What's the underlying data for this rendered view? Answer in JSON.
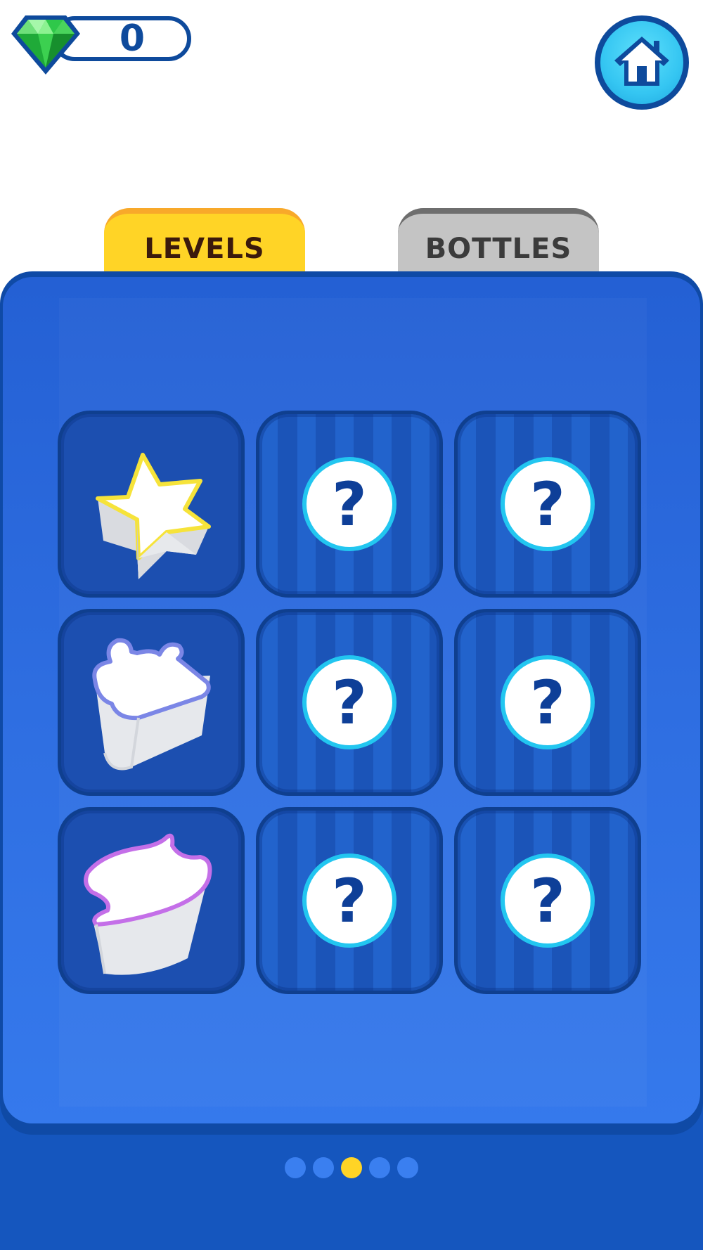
{
  "hud": {
    "gem_count": "0",
    "gem_icon": "green-gem-icon",
    "home_icon": "home-icon"
  },
  "tabs": [
    {
      "label": "LEVELS",
      "active": true
    },
    {
      "label": "BOTTLES",
      "active": false
    }
  ],
  "colors": {
    "active_tab": "#ffd426",
    "inactive_tab": "#c4c4c4",
    "panel": "#2f6fe2",
    "accent_dark": "#0e4a9c",
    "question_ring": "#22c6f0",
    "gem": "#2fc84a"
  },
  "grid": {
    "items": [
      {
        "state": "unlocked",
        "icon": "star-shape-icon"
      },
      {
        "state": "locked",
        "icon": "question-mark-icon",
        "glyph": "?"
      },
      {
        "state": "locked",
        "icon": "question-mark-icon",
        "glyph": "?"
      },
      {
        "state": "unlocked",
        "icon": "puzzle-shape-icon"
      },
      {
        "state": "locked",
        "icon": "question-mark-icon",
        "glyph": "?"
      },
      {
        "state": "locked",
        "icon": "question-mark-icon",
        "glyph": "?"
      },
      {
        "state": "unlocked",
        "icon": "hat-shape-icon"
      },
      {
        "state": "locked",
        "icon": "question-mark-icon",
        "glyph": "?"
      },
      {
        "state": "locked",
        "icon": "question-mark-icon",
        "glyph": "?"
      }
    ]
  },
  "pagination": {
    "total_pages": 5,
    "current_page": 3
  }
}
